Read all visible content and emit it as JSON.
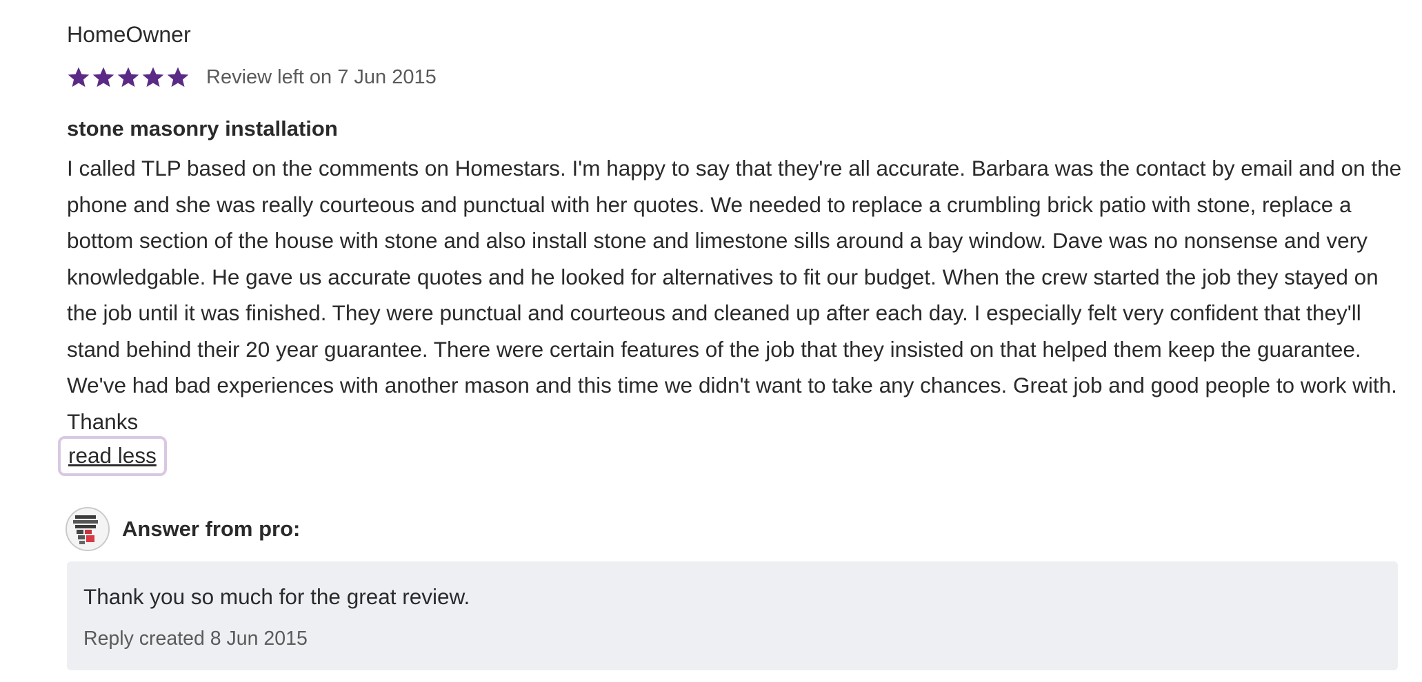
{
  "review": {
    "reviewer_name": "HomeOwner",
    "rating": 5,
    "rating_max": 5,
    "star_color": "#5b2a86",
    "date_text": "Review left on 7 Jun 2015",
    "title": "stone masonry installation",
    "body": "I called TLP based on the comments on Homestars. I'm happy to say that they're all accurate. Barbara was the contact by email and on the phone and she was really courteous and punctual with her quotes. We needed to replace a crumbling brick patio with stone, replace a bottom section of the house with stone and also install stone and limestone sills around a bay window. Dave was no nonsense and very knowledgable. He gave us accurate quotes and he looked for alternatives to fit our budget. When the crew started the job they stayed on the job until it was finished. They were punctual and courteous and cleaned up after each day. I especially felt very confident that they'll stand behind their 20 year guarantee. There were certain features of the job that they insisted on that helped them keep the guarantee. We've had bad experiences with another mason and this time we didn't want to take any chances. Great job and good people to work with. Thanks",
    "read_less_label": "read less"
  },
  "pro_answer": {
    "heading": "Answer from pro:",
    "avatar_icon": "company-logo-avatar",
    "reply_text": "Thank you so much for the great review.",
    "reply_date": "Reply created 8 Jun 2015"
  }
}
